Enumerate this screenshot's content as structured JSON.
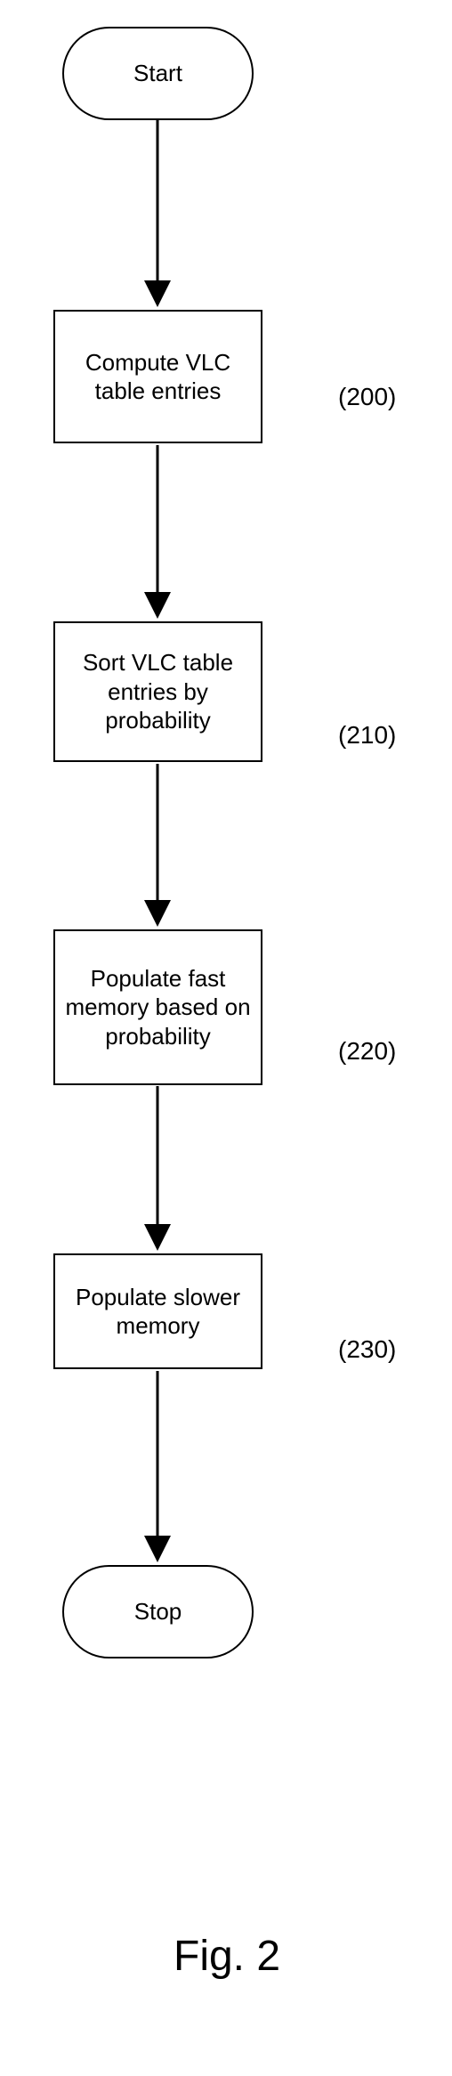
{
  "terminator_start": "Start",
  "terminator_stop": "Stop",
  "steps": {
    "s200": {
      "text": "Compute VLC table entries",
      "label": "(200)"
    },
    "s210": {
      "text": "Sort VLC table entries by probability",
      "label": "(210)"
    },
    "s220": {
      "text": "Populate fast memory based on probability",
      "label": "(220)"
    },
    "s230": {
      "text": "Populate slower memory",
      "label": "(230)"
    }
  },
  "caption": "Fig. 2",
  "chart_data": {
    "type": "flowchart",
    "title": "Fig. 2",
    "nodes": [
      {
        "id": "start",
        "type": "terminator",
        "label": "Start"
      },
      {
        "id": "200",
        "type": "process",
        "label": "Compute VLC table entries",
        "ref": "(200)"
      },
      {
        "id": "210",
        "type": "process",
        "label": "Sort VLC table entries by probability",
        "ref": "(210)"
      },
      {
        "id": "220",
        "type": "process",
        "label": "Populate fast memory based on probability",
        "ref": "(220)"
      },
      {
        "id": "230",
        "type": "process",
        "label": "Populate slower memory",
        "ref": "(230)"
      },
      {
        "id": "stop",
        "type": "terminator",
        "label": "Stop"
      }
    ],
    "edges": [
      {
        "from": "start",
        "to": "200"
      },
      {
        "from": "200",
        "to": "210"
      },
      {
        "from": "210",
        "to": "220"
      },
      {
        "from": "220",
        "to": "230"
      },
      {
        "from": "230",
        "to": "stop"
      }
    ]
  }
}
